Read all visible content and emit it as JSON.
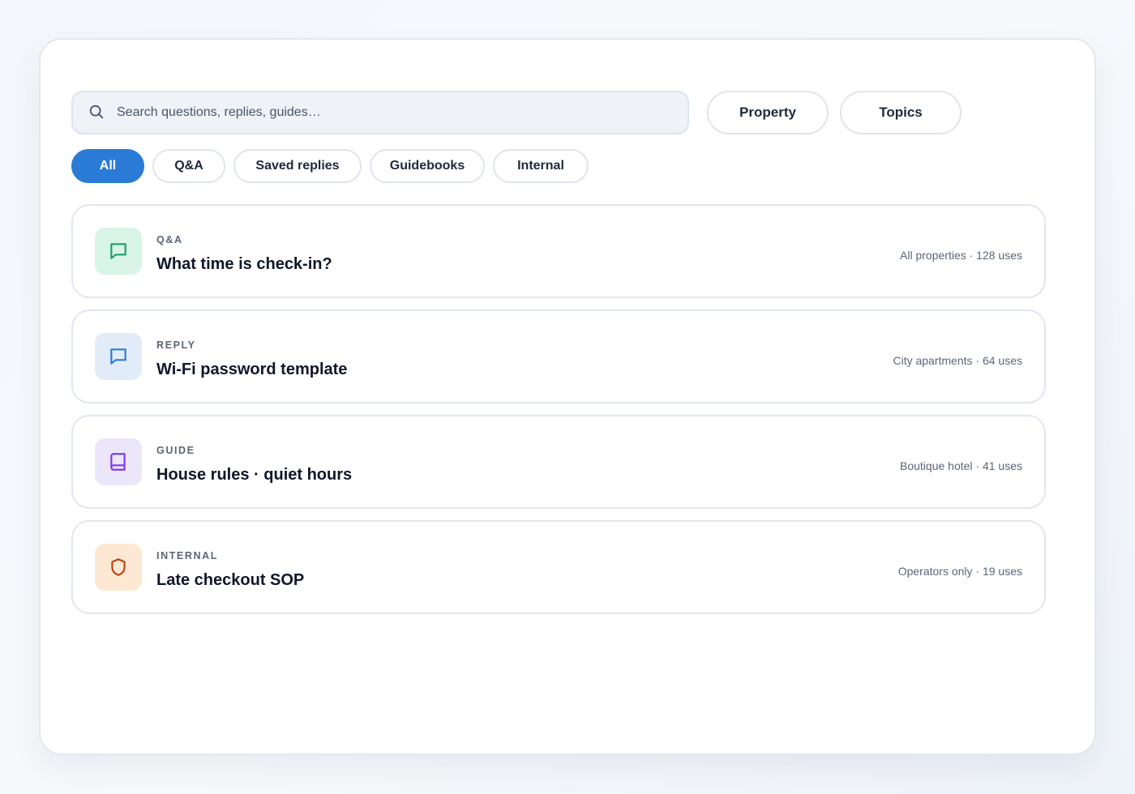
{
  "search": {
    "placeholder": "Search questions, replies, guides…",
    "value": ""
  },
  "filters": {
    "property_label": "Property",
    "topics_label": "Topics"
  },
  "chips": [
    {
      "label": "All",
      "active": true
    },
    {
      "label": "Q&A",
      "active": false
    },
    {
      "label": "Saved replies",
      "active": false
    },
    {
      "label": "Guidebooks",
      "active": false
    },
    {
      "label": "Internal",
      "active": false
    }
  ],
  "cards": [
    {
      "kind": "Q&A",
      "title": "What time is check-in?",
      "meta": "All properties · 128 uses",
      "icon": "chat-bubble-icon",
      "icon_color": "#1f9d6b",
      "badge_color": "#d8f5e7"
    },
    {
      "kind": "REPLY",
      "title": "Wi-Fi password template",
      "meta": "City apartments · 64 uses",
      "icon": "chat-bubble-icon",
      "icon_color": "#2a7bd5",
      "badge_color": "#e2ecf8"
    },
    {
      "kind": "GUIDE",
      "title": "House rules · quiet hours",
      "meta": "Boutique hotel · 41 uses",
      "icon": "book-icon",
      "icon_color": "#7c3aed",
      "badge_color": "#ece6fb"
    },
    {
      "kind": "INTERNAL",
      "title": "Late checkout SOP",
      "meta": "Operators only · 19 uses",
      "icon": "shield-icon",
      "icon_color": "#c2410c",
      "badge_color": "#fde9d3"
    }
  ],
  "colors": {
    "accent": "#2a7bd5"
  }
}
